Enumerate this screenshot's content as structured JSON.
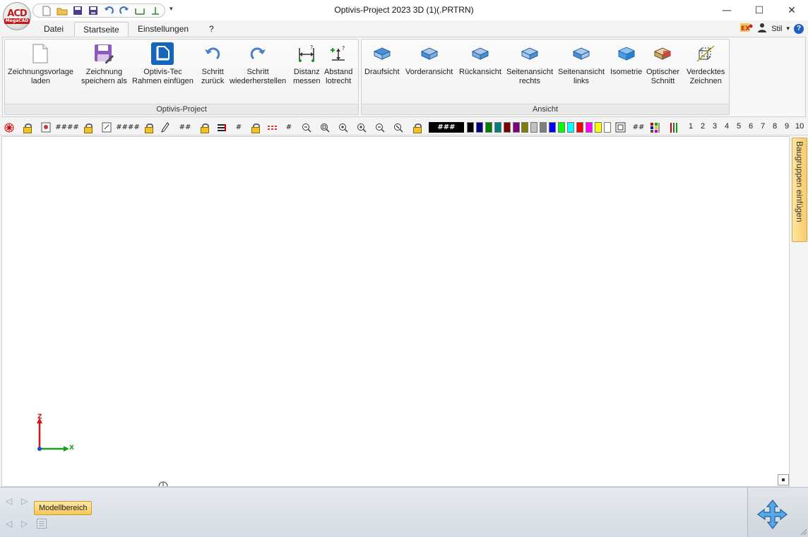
{
  "window": {
    "title": "Optivis-Project 2023 3D (1)(.PRTRN)",
    "logo_text": "ACD",
    "logo_sub": "MegaCAD",
    "qat_more": "▾",
    "min": "—",
    "max": "☐",
    "close": "✕"
  },
  "tabs": [
    "Datei",
    "Startseite",
    "Einstellungen",
    "?"
  ],
  "tab_right": {
    "style_label": "Stil",
    "style_arrow": "▾",
    "help": "?"
  },
  "groups": {
    "project": {
      "label": "Optivis-Project",
      "buttons": [
        {
          "label": "Zeichnungsvorlage\nladen"
        },
        {
          "label": "Zeichnung\nspeichern als"
        },
        {
          "label": "Optivis-Tec\nRahmen einfügen"
        },
        {
          "label": "Schritt\nzurück"
        },
        {
          "label": "Schritt\nwiederherstellen"
        },
        {
          "label": "Distanz\nmessen"
        },
        {
          "label": "Abstand\nlotrecht"
        }
      ]
    },
    "view": {
      "label": "Ansicht",
      "buttons": [
        {
          "label": "Draufsicht"
        },
        {
          "label": "Vorderansicht"
        },
        {
          "label": "Rückansicht"
        },
        {
          "label": "Seitenansicht\nrechts"
        },
        {
          "label": "Seitenansicht\nlinks"
        },
        {
          "label": "Isometrie"
        },
        {
          "label": "Optischer\nSchnitt"
        },
        {
          "label": "Verdecktes\nZeichnen"
        }
      ]
    }
  },
  "toolbar": {
    "hash4a": "####",
    "hash4b": "####",
    "hash2": "##",
    "hash1a": "#",
    "hash1b": "#",
    "hash_bar": "###",
    "hash2b": "##",
    "numbers": [
      "1",
      "2",
      "3",
      "4",
      "5",
      "6",
      "7",
      "8",
      "9",
      "10"
    ],
    "colors": [
      "#000000",
      "#00007f",
      "#007f00",
      "#007f7f",
      "#7f0000",
      "#7f007f",
      "#7f7f00",
      "#c0c0c0",
      "#7f7f7f",
      "#0000ff",
      "#00ff00",
      "#00ffff",
      "#ff0000",
      "#ff00ff",
      "#ffff00",
      "#ffffff"
    ]
  },
  "sidepanel": {
    "label": "Baugruppen einfügen"
  },
  "axes": {
    "z": "Z",
    "x": "X"
  },
  "bottom": {
    "model_tab": "Modellbereich"
  }
}
